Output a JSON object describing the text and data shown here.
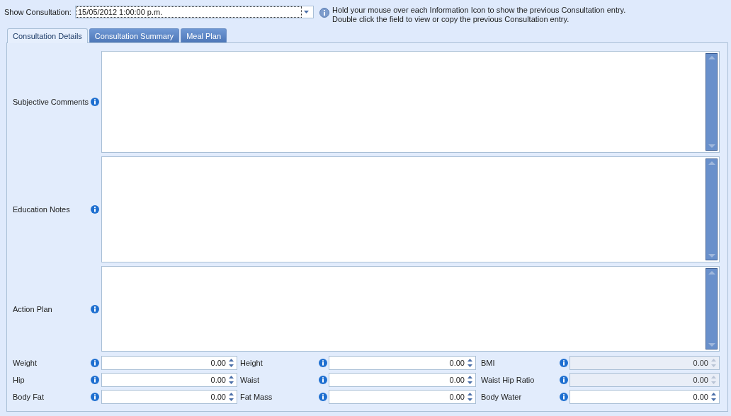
{
  "consultation_picker": {
    "label": "Show Consultation:",
    "value": "15/05/2012 1:00:00 p.m."
  },
  "hint": {
    "lines": [
      "Hold your mouse over each Information Icon to show the previous Consultation entry.",
      "Double click the field to view or copy the previous Consultation entry."
    ]
  },
  "tabs": [
    {
      "label": "Consultation Details",
      "selected": true
    },
    {
      "label": "Consultation Summary",
      "selected": false
    },
    {
      "label": "Meal Plan",
      "selected": false
    }
  ],
  "notes": [
    {
      "label": "Subjective Comments"
    },
    {
      "label": "Education Notes"
    },
    {
      "label": "Action Plan"
    }
  ],
  "measurements": [
    {
      "label": "Weight",
      "value": "0.00",
      "disabled": false
    },
    {
      "label": "Height",
      "value": "0.00",
      "disabled": false
    },
    {
      "label": "BMI",
      "value": "0.00",
      "disabled": true
    },
    {
      "label": "Hip",
      "value": "0.00",
      "disabled": false
    },
    {
      "label": "Waist",
      "value": "0.00",
      "disabled": false
    },
    {
      "label": "Waist Hip Ratio",
      "value": "0.00",
      "disabled": true
    },
    {
      "label": "Body Fat",
      "value": "0.00",
      "disabled": false
    },
    {
      "label": "Fat Mass",
      "value": "0.00",
      "disabled": false
    },
    {
      "label": "Body Water",
      "value": "0.00",
      "disabled": false
    }
  ]
}
